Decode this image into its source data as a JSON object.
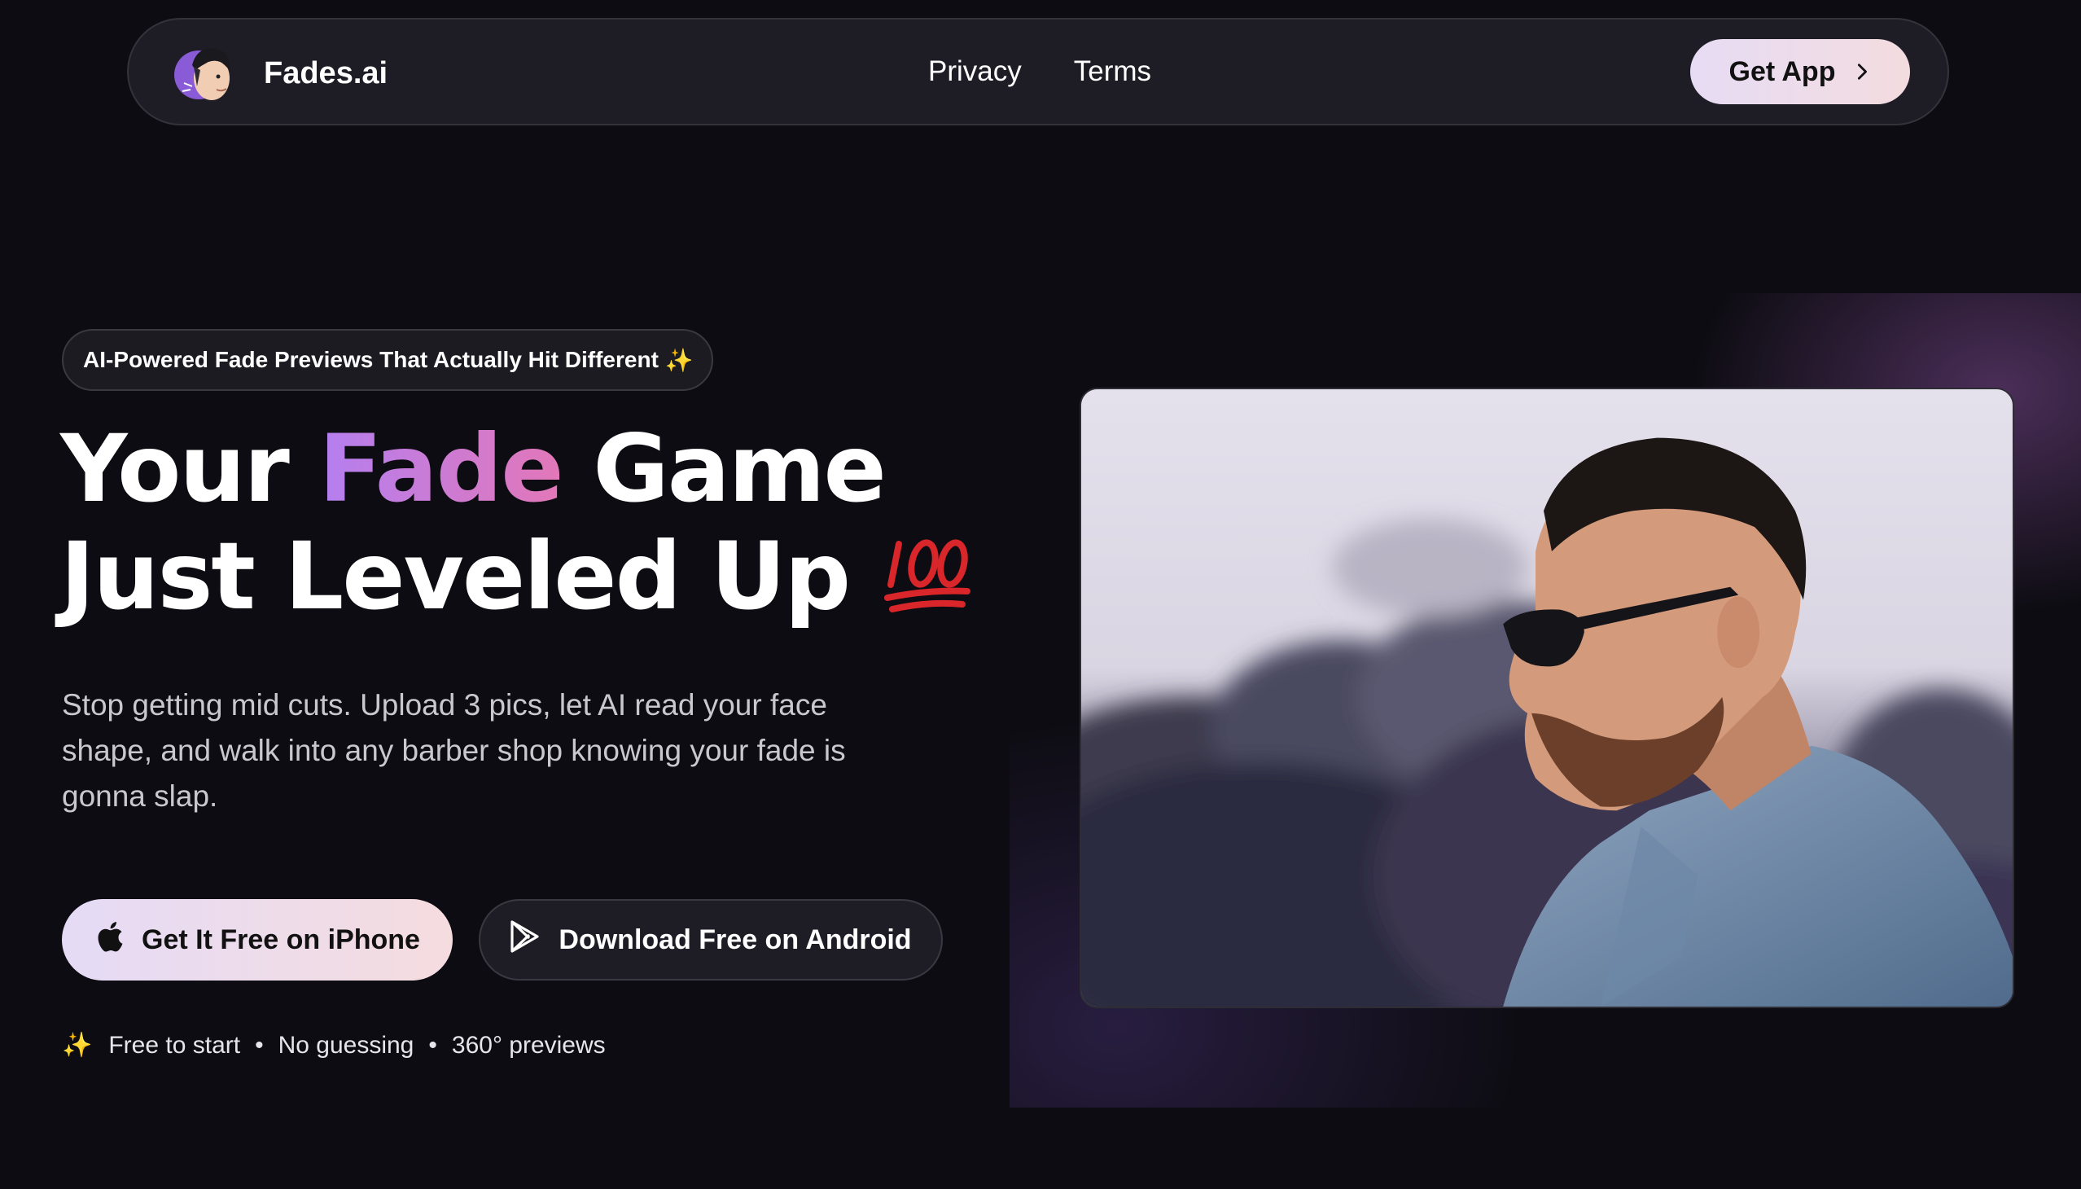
{
  "nav": {
    "brand_name": "Fades.ai",
    "logo_icon": "barber-avatar-icon",
    "links": [
      "Privacy",
      "Terms"
    ],
    "cta_label": "Get App",
    "cta_icon": "chevron-right-icon"
  },
  "hero": {
    "tagline": "AI-Powered Fade Previews That Actually Hit Different",
    "tagline_emoji": "✨",
    "headline_part1": "Your ",
    "headline_highlight": "Fade",
    "headline_part2": " Game",
    "headline_line2": "Just Leveled Up",
    "headline_emoji": "💯",
    "subtext": "Stop getting mid cuts. Upload 3 pics, let AI read your face shape, and walk into any barber shop knowing your fade is gonna slap.",
    "ios_button": {
      "label": "Get It Free on iPhone",
      "icon": "apple-icon"
    },
    "android_button": {
      "label": "Download Free on Android",
      "icon": "google-play-icon"
    },
    "features_emoji": "✨",
    "features": [
      "Free to start",
      "No guessing",
      "360° previews"
    ],
    "feature_separator": "•",
    "image": "man-with-fade-haircut-sunglasses-denim-jacket"
  },
  "colors": {
    "background": "#0d0c12",
    "nav_background": "#1e1d25",
    "accent_gradient_start": "#b47ff0",
    "accent_gradient_end": "#e377b8",
    "cta_gradient_start": "#e5dbf6",
    "cta_gradient_end": "#f5dcdf"
  }
}
